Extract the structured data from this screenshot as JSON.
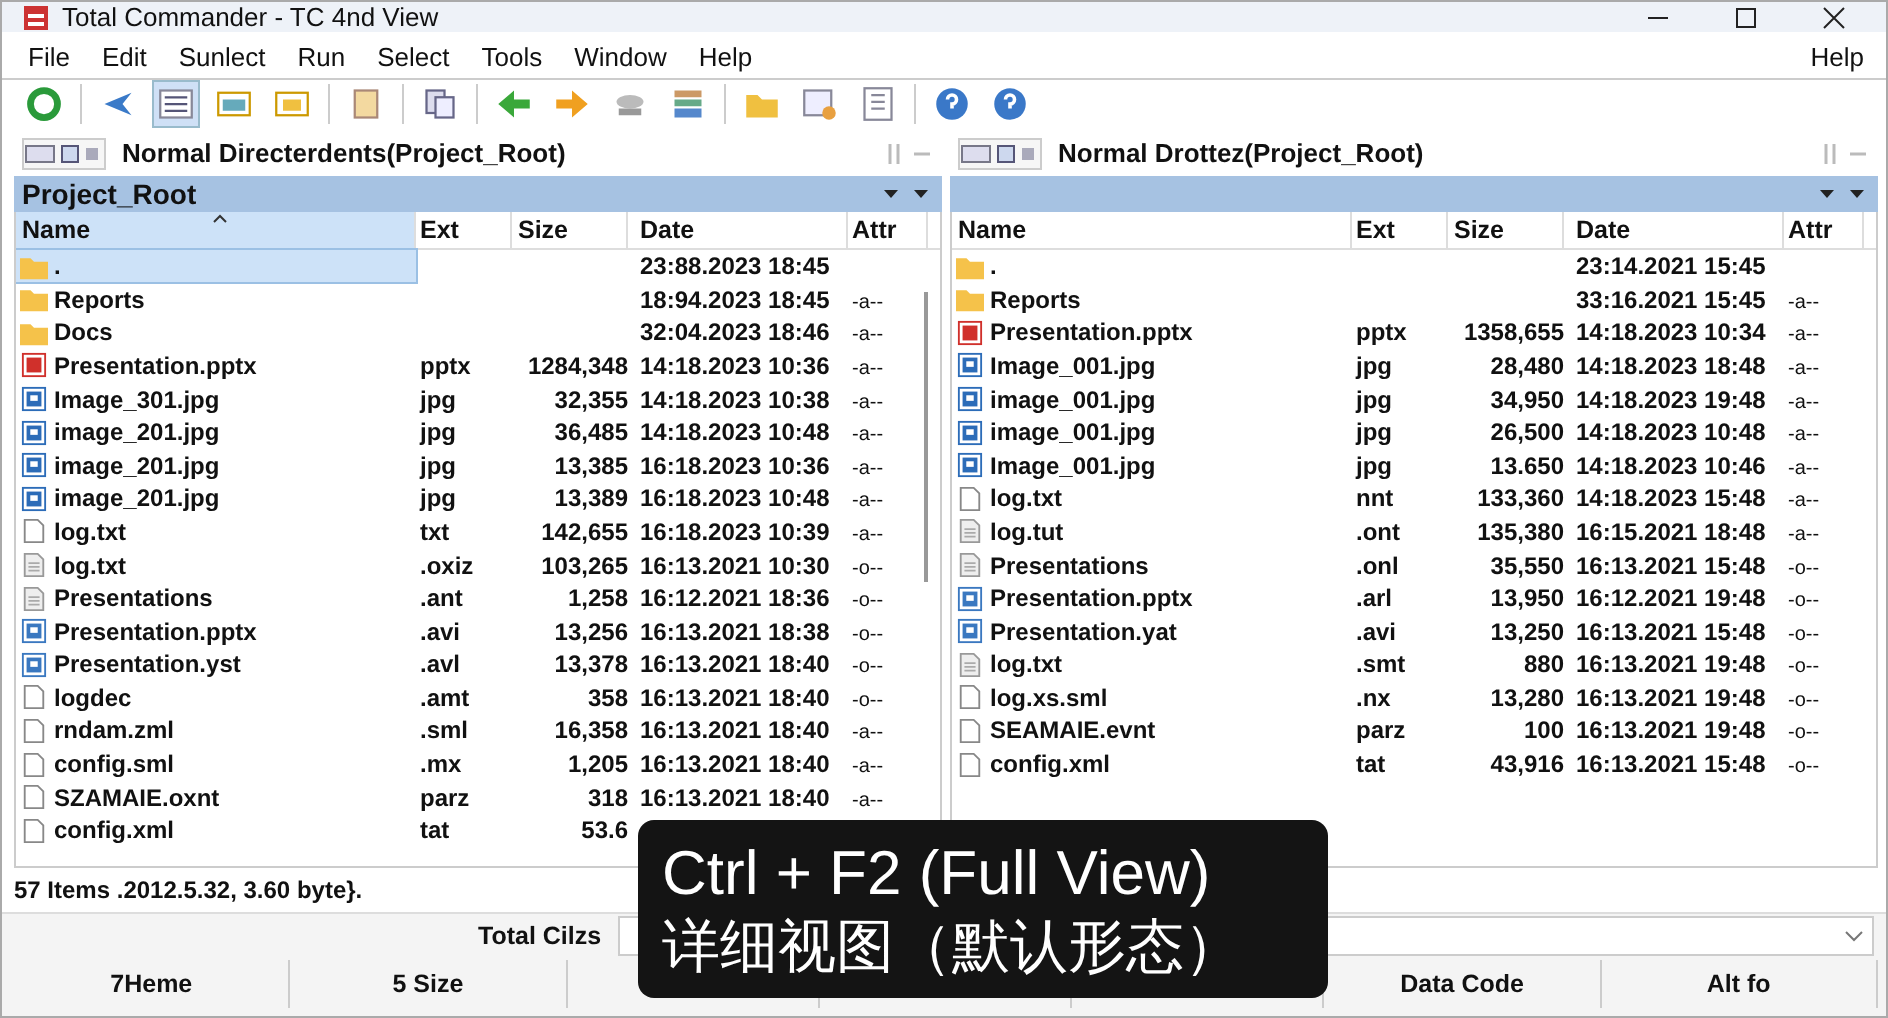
{
  "window": {
    "title": "Total Commander - TC 4nd View"
  },
  "menu": [
    {
      "label": "File"
    },
    {
      "label": "Edit"
    },
    {
      "label": "Sunlect"
    },
    {
      "label": "Run"
    },
    {
      "label": "Select"
    },
    {
      "label": "Tools"
    },
    {
      "label": "Window"
    },
    {
      "label": "Help"
    }
  ],
  "menu_right": "Help",
  "panels": [
    {
      "title": "Normal Directerdents(Project_Root)",
      "path": "Project_Root",
      "columns": [
        {
          "label": "Name",
          "sorted": true
        },
        {
          "label": "Ext",
          "sorted": false
        },
        {
          "label": "Size",
          "sorted": false
        },
        {
          "label": "Date",
          "sorted": false
        },
        {
          "label": "Attr",
          "sorted": false
        }
      ],
      "rows": [
        {
          "name": ".",
          "kind": "folder",
          "date": "23:88.2023 18:45",
          "selected": true
        },
        {
          "name": "Reports",
          "kind": "folder",
          "date": "18:94.2023 18:45",
          "attr": "-a--",
          "selected": false
        },
        {
          "name": "Docs",
          "kind": "folder",
          "date": "32:04.2023 18:46",
          "attr": "-a--",
          "selected": false
        },
        {
          "name": "Presentation.pptx",
          "kind": "pptx",
          "ext": "pptx",
          "size": "1284,348",
          "date": "14:18.2023 10:36",
          "attr": "-a--",
          "selected": false
        },
        {
          "name": "Image_301.jpg",
          "kind": "image",
          "ext": "jpg",
          "size": "32,355",
          "date": "14:18.2023 10:38",
          "attr": "-a--",
          "selected": false
        },
        {
          "name": "image_201.jpg",
          "kind": "image",
          "ext": "jpg",
          "size": "36,485",
          "date": "14:18.2023 10:48",
          "attr": "-a--",
          "selected": false
        },
        {
          "name": "image_201.jpg",
          "kind": "image",
          "ext": "jpg",
          "size": "13,385",
          "date": "16:18.2023 10:36",
          "attr": "-a--",
          "selected": false
        },
        {
          "name": "image_201.jpg",
          "kind": "image",
          "ext": "jpg",
          "size": "13,389",
          "date": "16:18.2023 10:48",
          "attr": "-a--",
          "selected": false
        },
        {
          "name": "log.txt",
          "kind": "blank",
          "ext": "txt",
          "size": "142,655",
          "date": "16:18.2023 10:39",
          "attr": "-a--",
          "selected": false
        },
        {
          "name": "log.txt",
          "kind": "lines",
          "ext": ".oxiz",
          "size": "103,265",
          "date": "16:13.2021 10:30",
          "attr": "-o--",
          "selected": false
        },
        {
          "name": "Presentations",
          "kind": "lines",
          "ext": ".ant",
          "size": "1,258",
          "date": "16:12.2021 18:36",
          "attr": "-o--",
          "selected": false
        },
        {
          "name": "Presentation.pptx",
          "kind": "doc",
          "ext": ".avi",
          "size": "13,256",
          "date": "16:13.2021 18:38",
          "attr": "-o--",
          "selected": false
        },
        {
          "name": "Presentation.yst",
          "kind": "doc",
          "ext": ".avl",
          "size": "13,378",
          "date": "16:13.2021 18:40",
          "attr": "-o--",
          "selected": false
        },
        {
          "name": "logdec",
          "kind": "blank",
          "ext": ".amt",
          "size": "358",
          "date": "16:13.2021 18:40",
          "attr": "-o--",
          "selected": false
        },
        {
          "name": "rndam.zml",
          "kind": "blank",
          "ext": ".sml",
          "size": "16,358",
          "date": "16:13.2021 18:40",
          "attr": "-a--",
          "selected": false
        },
        {
          "name": "config.sml",
          "kind": "blank",
          "ext": ".mx",
          "size": "1,205",
          "date": "16:13.2021 18:40",
          "attr": "-a--",
          "selected": false
        },
        {
          "name": "SZAMAIE.oxnt",
          "kind": "blank",
          "ext": "parz",
          "size": "318",
          "date": "16:13.2021 18:40",
          "attr": "-a--",
          "selected": false
        },
        {
          "name": "config.xml",
          "kind": "blank",
          "ext": "tat",
          "size": "53.6",
          "selected": false
        }
      ],
      "status": "57 Items .2012.5.32, 3.60 byte}."
    },
    {
      "title": "Normal Drottez(Project_Root)",
      "columns": [
        {
          "label": "Name",
          "sorted": false
        },
        {
          "label": "Ext",
          "sorted": false
        },
        {
          "label": "Size",
          "sorted": false
        },
        {
          "label": "Date",
          "sorted": false
        },
        {
          "label": "Attr",
          "sorted": false
        }
      ],
      "rows": [
        {
          "name": ".",
          "kind": "folder",
          "date": "23:14.2021 15:45",
          "selected": false
        },
        {
          "name": "Reports",
          "kind": "folder",
          "date": "33:16.2021 15:45",
          "attr": "-a--",
          "selected": false
        },
        {
          "name": "Presentation.pptx",
          "kind": "pptx",
          "ext": "pptx",
          "size": "1358,655",
          "date": "14:18.2023 10:34",
          "attr": "-a--",
          "selected": false
        },
        {
          "name": "Image_001.jpg",
          "kind": "image",
          "ext": "jpg",
          "size": "28,480",
          "date": "14:18.2023 18:48",
          "attr": "-a--",
          "selected": false
        },
        {
          "name": "image_001.jpg",
          "kind": "image",
          "ext": "jpg",
          "size": "34,950",
          "date": "14:18.2023 19:48",
          "attr": "-a--",
          "selected": false
        },
        {
          "name": "image_001.jpg",
          "kind": "image",
          "ext": "jpg",
          "size": "26,500",
          "date": "14:18.2023 10:48",
          "attr": "-a--",
          "selected": false
        },
        {
          "name": "Image_001.jpg",
          "kind": "image",
          "ext": "jpg",
          "size": "13.650",
          "date": "14:18.2023 10:46",
          "attr": "-a--",
          "selected": false
        },
        {
          "name": "log.txt",
          "kind": "blank",
          "ext": "nnt",
          "size": "133,360",
          "date": "14:18.2023 15:48",
          "attr": "-a--",
          "selected": false
        },
        {
          "name": "log.tut",
          "kind": "lines",
          "ext": ".ont",
          "size": "135,380",
          "date": "16:15.2021 18:48",
          "attr": "-a--",
          "selected": false
        },
        {
          "name": "Presentations",
          "kind": "lines",
          "ext": ".onl",
          "size": "35,550",
          "date": "16:13.2021 15:48",
          "attr": "-o--",
          "selected": false
        },
        {
          "name": "Presentation.pptx",
          "kind": "doc",
          "ext": ".arl",
          "size": "13,950",
          "date": "16:12.2021 19:48",
          "attr": "-o--",
          "selected": false
        },
        {
          "name": "Presentation.yat",
          "kind": "doc",
          "ext": ".avi",
          "size": "13,250",
          "date": "16:13.2021 15:48",
          "attr": "-o--",
          "selected": false
        },
        {
          "name": "log.txt",
          "kind": "lines",
          "ext": ".smt",
          "size": "880",
          "date": "16:13.2021 19:48",
          "attr": "-o--",
          "selected": false
        },
        {
          "name": "log.xs.sml",
          "kind": "blank",
          "ext": ".nx",
          "size": "13,280",
          "date": "16:13.2021 19:48",
          "attr": "-o--",
          "selected": false
        },
        {
          "name": "SEAMAIE.evnt",
          "kind": "blank",
          "ext": "parz",
          "size": "100",
          "date": "16:13.2021 19:48",
          "attr": "-o--",
          "selected": false
        },
        {
          "name": "config.xml",
          "kind": "blank",
          "ext": "tat",
          "size": "43,916",
          "date": "16:13.2021 15:48",
          "attr": "-o--",
          "selected": false
        }
      ]
    }
  ],
  "command_line": {
    "label": "Total Cilzs"
  },
  "function_keys": [
    {
      "label": "7Heme"
    },
    {
      "label": "5 Size"
    },
    {
      "label": "Data Code"
    },
    {
      "label": "Alt fo"
    }
  ],
  "caption": {
    "lines": [
      "Ctrl + F2 (Full View)",
      "详细视图（默认形态）"
    ]
  }
}
